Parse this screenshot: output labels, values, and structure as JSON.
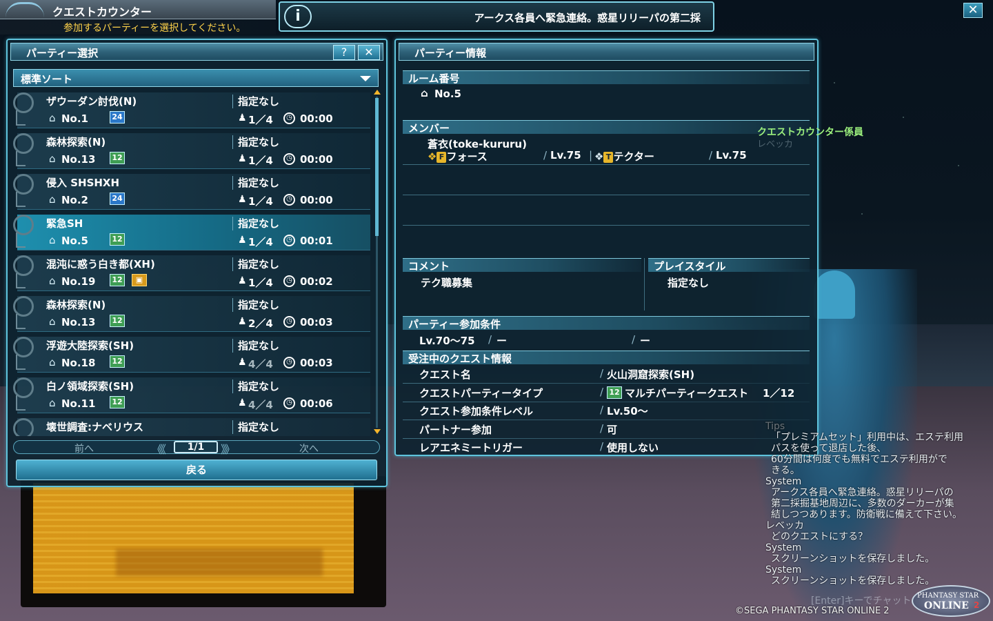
{
  "header": {
    "title": "クエストカウンター",
    "subtitle": "参加するパーティーを選択してください。",
    "info_icon": "i",
    "info_message": "アークス各員へ緊急連絡。惑星リリーパの第二採",
    "close": "✕"
  },
  "party_select": {
    "title": "パーティー選択",
    "help": "?",
    "close": "✕",
    "sort_label": "標準ソート",
    "rows": [
      {
        "name": "ザウーダン討伐(N)",
        "cond": "指定なし",
        "room": "No.1",
        "badge": "24",
        "badge_color": "blue",
        "count": "1／4",
        "time": "00:00",
        "full": false,
        "locked": false,
        "selected": false
      },
      {
        "name": "森林探索(N)",
        "cond": "指定なし",
        "room": "No.13",
        "badge": "12",
        "badge_color": "green",
        "count": "1／4",
        "time": "00:00",
        "full": false,
        "locked": false,
        "selected": false
      },
      {
        "name": "侵入 SHSHXH",
        "cond": "指定なし",
        "room": "No.2",
        "badge": "24",
        "badge_color": "blue",
        "count": "1／4",
        "time": "00:00",
        "full": false,
        "locked": false,
        "selected": false
      },
      {
        "name": "緊急SH",
        "cond": "指定なし",
        "room": "No.5",
        "badge": "12",
        "badge_color": "green",
        "count": "1／4",
        "time": "00:01",
        "full": false,
        "locked": false,
        "selected": true
      },
      {
        "name": "混沌に惑う白き都(XH)",
        "cond": "指定なし",
        "room": "No.19",
        "badge": "12",
        "badge_color": "green",
        "count": "1／4",
        "time": "00:02",
        "full": false,
        "locked": true,
        "selected": false
      },
      {
        "name": "森林探索(N)",
        "cond": "指定なし",
        "room": "No.13",
        "badge": "12",
        "badge_color": "green",
        "count": "2／4",
        "time": "00:03",
        "full": false,
        "locked": false,
        "selected": false
      },
      {
        "name": "浮遊大陸探索(SH)",
        "cond": "指定なし",
        "room": "No.18",
        "badge": "12",
        "badge_color": "green",
        "count": "4／4",
        "time": "00:03",
        "full": true,
        "locked": false,
        "selected": false
      },
      {
        "name": "白ノ領域探索(SH)",
        "cond": "指定なし",
        "room": "No.11",
        "badge": "12",
        "badge_color": "green",
        "count": "4／4",
        "time": "00:06",
        "full": true,
        "locked": false,
        "selected": false
      },
      {
        "name": "壊世調査:ナベリウス",
        "cond": "指定なし",
        "room": "",
        "badge": "",
        "badge_color": "",
        "count": "",
        "time": "",
        "full": false,
        "locked": false,
        "selected": false
      }
    ],
    "pager": {
      "prev": "前へ",
      "next": "次へ",
      "page": "1/1"
    },
    "back": "戻る"
  },
  "party_info": {
    "title": "パーティー情報",
    "room_head": "ルーム番号",
    "room_value": "No.5",
    "member_head": "メンバー",
    "member_name": "蒼衣(toke-kururu)",
    "main_class": "フォース",
    "main_level": "Lv.75",
    "sub_class": "テクター",
    "sub_level": "Lv.75",
    "comment_head": "コメント",
    "comment_value": "テク職募集",
    "playstyle_head": "プレイスタイル",
    "playstyle_value": "指定なし",
    "conditions_head": "パーティー参加条件",
    "cond_level": "Lv.70〜75",
    "cond_a": "ー",
    "cond_b": "ー",
    "quest_head": "受注中のクエスト情報",
    "quest_rows": [
      {
        "label": "クエスト名",
        "value": "火山洞窟探索(SH)"
      },
      {
        "label": "クエストパーティータイプ",
        "value": "マルチパーティークエスト",
        "extra": "1／12"
      },
      {
        "label": "クエスト参加条件レベル",
        "value": "Lv.50〜"
      },
      {
        "label": "パートナー参加",
        "value": "可"
      },
      {
        "label": "レアエネミートリガー",
        "value": "使用しない"
      }
    ]
  },
  "npc": {
    "label": "クエストカウンター係員",
    "sub": "レベッカ"
  },
  "chat": {
    "lines": [
      {
        "text": "Tips",
        "dim": true
      },
      {
        "text": "「プレミアムセット」利用中は、エステ利用",
        "dim": false
      },
      {
        "text": "パスを使って退店した後、",
        "dim": false
      },
      {
        "text": "60分間は何度でも無料でエステ利用がで",
        "dim": false
      },
      {
        "text": "きる。",
        "dim": false
      },
      {
        "text": "System",
        "dim": false
      },
      {
        "text": "アークス各員へ緊急連絡。惑星リリーパの",
        "dim": false
      },
      {
        "text": "第二採掘基地周辺に、多数のダーカーが集",
        "dim": false
      },
      {
        "text": "結しつつあります。防衛戦に備えて下さい。",
        "dim": false
      },
      {
        "text": "レベッカ",
        "dim": false
      },
      {
        "text": "どのクエストにする？",
        "dim": false
      },
      {
        "text": "System",
        "dim": false
      },
      {
        "text": "スクリーンショットを保存しました。",
        "dim": false
      },
      {
        "text": "System",
        "dim": false
      },
      {
        "text": "スクリーンショットを保存しました。",
        "dim": false
      }
    ],
    "input_hint": "[Enter]キーでチャット",
    "copyright": "©SEGA PHANTASY STAR ONLINE 2",
    "logo_line1": "PHANTASY STAR",
    "logo_line2": "ONLINE",
    "logo_line3": "2"
  }
}
